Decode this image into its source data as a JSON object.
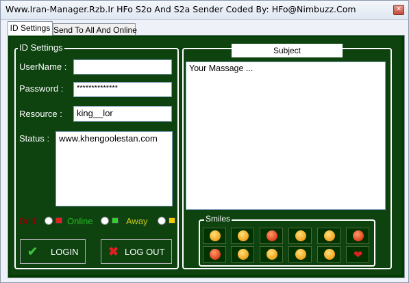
{
  "window": {
    "title": "Www.Iran-Manager.Rzb.Ir HFo S2o And S2a Sender Coded By: HFo@Nimbuzz.Com",
    "close_glyph": "✕"
  },
  "tabs": [
    {
      "label": "ID Settings",
      "selected": true
    },
    {
      "label": "Send To All And Online",
      "selected": false
    }
  ],
  "id_settings": {
    "legend": "ID Settings",
    "username_label": "UserName :",
    "username_value": "",
    "password_label": "Password :",
    "password_value": "**************",
    "resource_label": "Resource :",
    "resource_value": "king__lor",
    "status_label": "Status :",
    "status_value": "www.khengoolestan.com"
  },
  "presence": {
    "dnd_label": "Dnd",
    "online_label": "Online",
    "away_label": "Away",
    "colors": {
      "dnd": "#8b0000",
      "online": "#1fbf1f",
      "away": "#c8c81e"
    }
  },
  "buttons": {
    "login_label": "LOGIN",
    "logout_label": "LOG OUT"
  },
  "message": {
    "subject_label": "Subject",
    "body": "Your Massage ..."
  },
  "smiles": {
    "legend": "Smiles",
    "icons": [
      "smile-icon",
      "angry-icon",
      "surprised-icon",
      "happy-icon",
      "angel-icon",
      "evil-grin-icon",
      "kiss-icon",
      "tongue-icon",
      "confused-icon",
      "sad-icon",
      "laugh-icon",
      "heart-icon"
    ]
  }
}
